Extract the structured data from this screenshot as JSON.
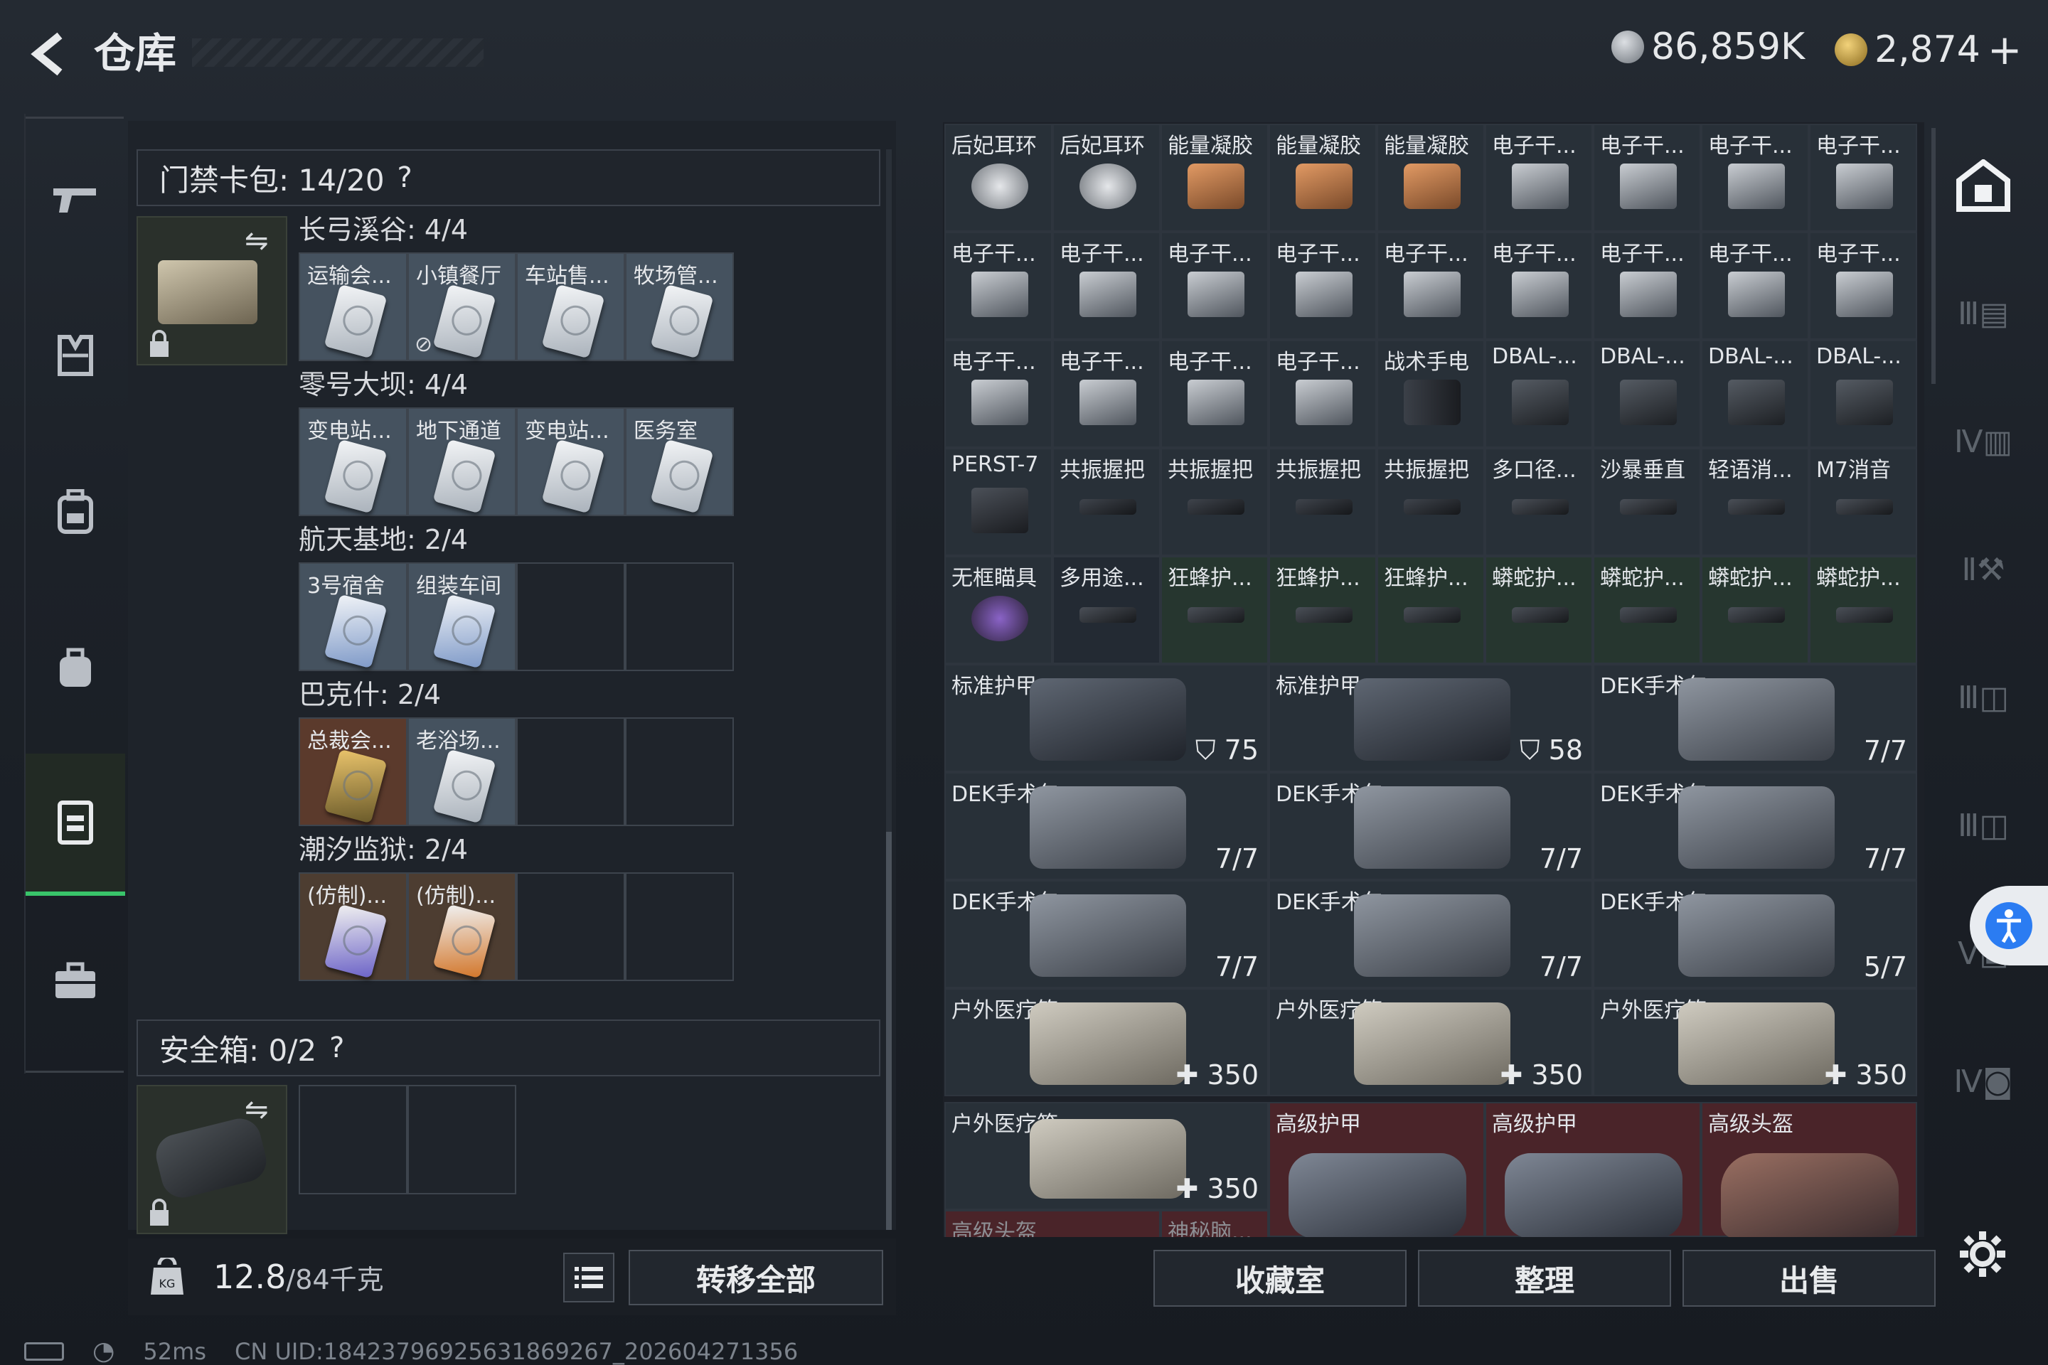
{
  "header": {
    "title": "仓库",
    "currency1": "86,859K",
    "currency2": "2,874",
    "plus": "+"
  },
  "keycard": {
    "title": "门禁卡包: 14/20",
    "help": "?",
    "groups": [
      {
        "label": "长弓溪谷: 4/4",
        "slots": [
          "运输会...",
          "小镇餐厅",
          "车站售...",
          "牧场管..."
        ]
      },
      {
        "label": "零号大坝: 4/4",
        "slots": [
          "变电站...",
          "地下通道",
          "变电站...",
          "医务室"
        ]
      },
      {
        "label": "航天基地: 2/4",
        "slots": [
          "3号宿舍",
          "组装车间"
        ]
      },
      {
        "label": "巴克什: 2/4",
        "slots": [
          "总裁会...",
          "老浴场..."
        ]
      },
      {
        "label": "潮汐监狱: 2/4",
        "slots": [
          "(仿制)...",
          "(仿制)..."
        ]
      }
    ]
  },
  "safebox": {
    "title": "安全箱: 0/2",
    "help": "?"
  },
  "weight": {
    "value": "12.8",
    "max": "/84千克"
  },
  "buttons": {
    "transfer": "转移全部",
    "collection": "收藏室",
    "organize": "整理",
    "sell": "出售"
  },
  "grid_small": [
    [
      "后妃耳环",
      "后妃耳环",
      "能量凝胶",
      "能量凝胶",
      "能量凝胶",
      "电子干...",
      "电子干...",
      "电子干...",
      "电子干..."
    ],
    [
      "电子干...",
      "电子干...",
      "电子干...",
      "电子干...",
      "电子干...",
      "电子干...",
      "电子干...",
      "电子干...",
      "电子干..."
    ],
    [
      "电子干...",
      "电子干...",
      "电子干...",
      "电子干...",
      "战术手电",
      "DBAL-...",
      "DBAL-...",
      "DBAL-...",
      "DBAL-..."
    ],
    [
      "PERST-7",
      "共振握把",
      "共振握把",
      "共振握把",
      "共振握把",
      "多口径...",
      "沙暴垂直",
      "轻语消...",
      "M7消音"
    ],
    [
      "无框瞄具",
      "多用途...",
      "狂蜂护...",
      "狂蜂护...",
      "狂蜂护...",
      "蟒蛇护...",
      "蟒蛇护...",
      "蟒蛇护...",
      "蟒蛇护..."
    ]
  ],
  "grid_large": [
    [
      {
        "label": "标准护甲",
        "value": "75"
      },
      {
        "label": "标准护甲",
        "value": "58"
      },
      {
        "label": "DEK手术包",
        "value": "7/7"
      }
    ],
    [
      {
        "label": "DEK手术包",
        "value": "7/7"
      },
      {
        "label": "DEK手术包",
        "value": "7/7"
      },
      {
        "label": "DEK手术包",
        "value": "7/7"
      }
    ],
    [
      {
        "label": "DEK手术包",
        "value": "7/7"
      },
      {
        "label": "DEK手术包",
        "value": "7/7"
      },
      {
        "label": "DEK手术包",
        "value": "5/7"
      }
    ],
    [
      {
        "label": "户外医疗箱",
        "value": "350"
      },
      {
        "label": "户外医疗箱",
        "value": "350"
      },
      {
        "label": "户外医疗箱",
        "value": "350"
      }
    ]
  ],
  "grid_last": {
    "med": {
      "label": "户外医疗箱",
      "value": "350"
    },
    "armor1": "高级护甲",
    "armor2": "高级护甲",
    "helmet": "高级头盔",
    "partial1": "高级头盔",
    "partial2": "神秘脑..."
  },
  "status": {
    "ping": "52ms",
    "uid": "CN UID:18423796925631869267_202604271356"
  }
}
